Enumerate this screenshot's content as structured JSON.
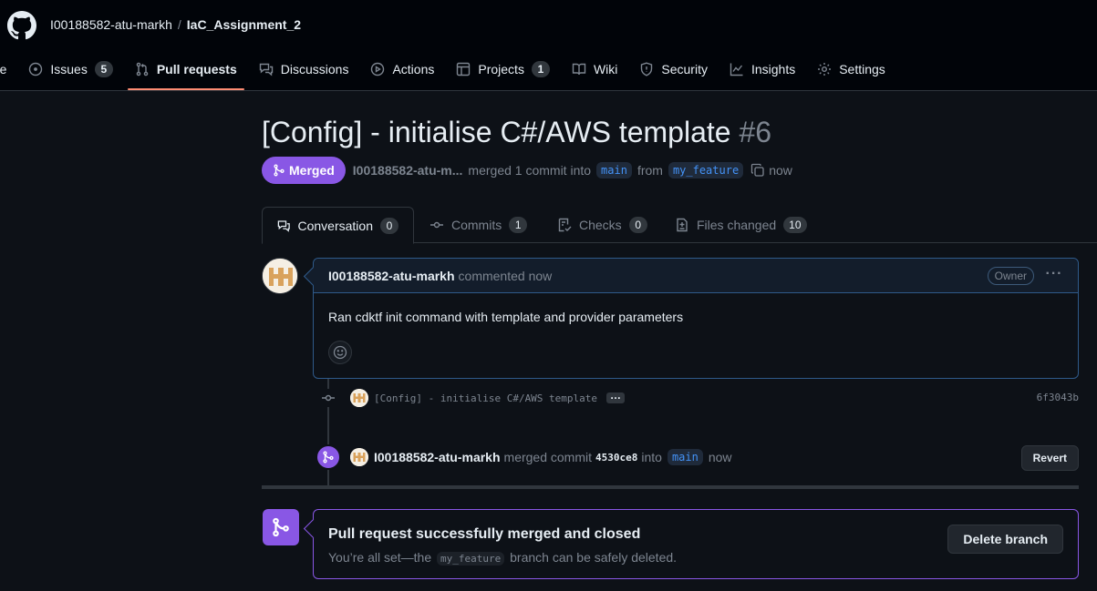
{
  "header": {
    "owner": "I00188582-atu-markh",
    "separator": "/",
    "repo": "IaC_Assignment_2"
  },
  "nav": {
    "code": "ode",
    "issues": "Issues",
    "issues_count": "5",
    "pull_requests": "Pull requests",
    "discussions": "Discussions",
    "actions": "Actions",
    "projects": "Projects",
    "projects_count": "1",
    "wiki": "Wiki",
    "security": "Security",
    "insights": "Insights",
    "settings": "Settings"
  },
  "pr": {
    "title": "[Config] - initialise C#/AWS template",
    "number": "#6",
    "state": "Merged",
    "author_short": "I00188582-atu-m...",
    "merge_text": "merged 1 commit into",
    "base_branch": "main",
    "from_text": "from",
    "head_branch": "my_feature",
    "time": "now"
  },
  "tabs": [
    {
      "label": "Conversation",
      "count": "0"
    },
    {
      "label": "Commits",
      "count": "1"
    },
    {
      "label": "Checks",
      "count": "0"
    },
    {
      "label": "Files changed",
      "count": "10"
    }
  ],
  "comment": {
    "author": "I00188582-atu-markh",
    "action": "commented now",
    "badge": "Owner",
    "more": "···",
    "body": "Ran cdktf init command with template and provider parameters"
  },
  "commit": {
    "message": "[Config] - initialise C#/AWS template",
    "more": "…",
    "sha": "6f3043b"
  },
  "merge_event": {
    "author": "I00188582-atu-markh",
    "text": "merged commit",
    "sha": "4530ce8",
    "into": "into",
    "branch": "main",
    "time": "now",
    "revert": "Revert"
  },
  "merged_box": {
    "title": "Pull request successfully merged and closed",
    "sub_before": "You’re all set—the",
    "branch": "my_feature",
    "sub_after": "branch can be safely deleted.",
    "button": "Delete branch"
  },
  "colors": {
    "merged": "#8957e5",
    "underline": "#fd8c73",
    "link": "#4493f8",
    "background": "#0d1117"
  }
}
